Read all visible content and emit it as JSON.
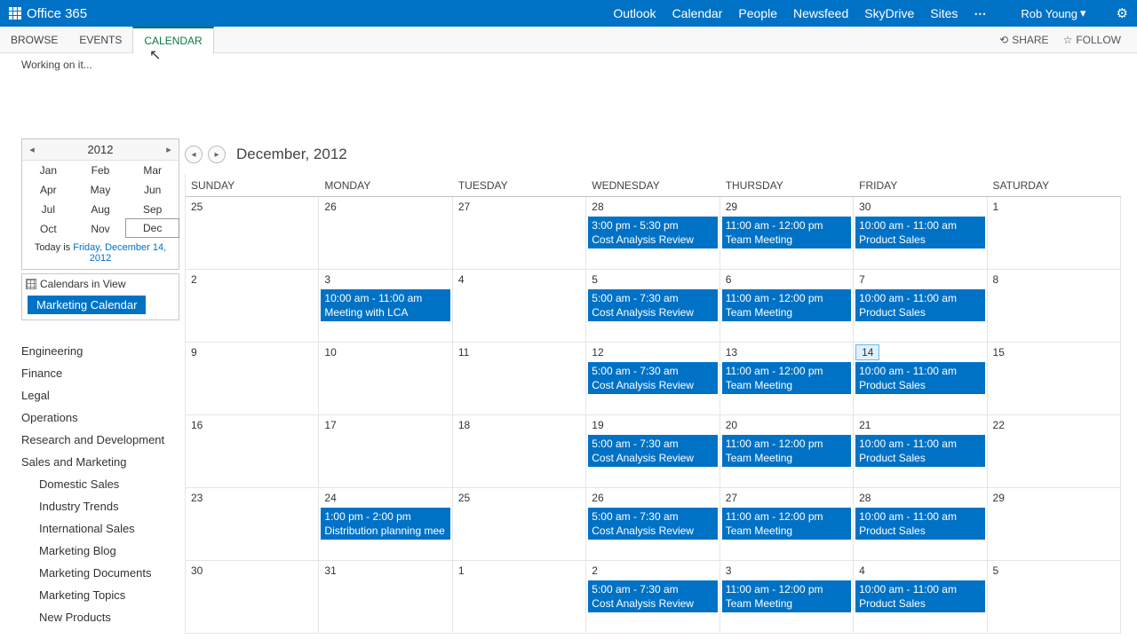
{
  "suite": {
    "brand": "Office 365",
    "nav": [
      "Outlook",
      "Calendar",
      "People",
      "Newsfeed",
      "SkyDrive",
      "Sites"
    ],
    "user": "Rob Young"
  },
  "ribbon": {
    "tabs": [
      "BROWSE",
      "EVENTS",
      "CALENDAR"
    ],
    "active": 2,
    "share": "SHARE",
    "follow": "FOLLOW",
    "status": "Working on it..."
  },
  "datepicker": {
    "year": "2012",
    "months": [
      "Jan",
      "Feb",
      "Mar",
      "Apr",
      "May",
      "Jun",
      "Jul",
      "Aug",
      "Sep",
      "Oct",
      "Nov",
      "Dec"
    ],
    "selected": "Dec",
    "today_prefix": "Today is ",
    "today_link": "Friday, December 14, 2012"
  },
  "civ": {
    "label": "Calendars in View",
    "selected": "Marketing Calendar"
  },
  "tree": {
    "nodes": [
      "Engineering",
      "Finance",
      "Legal",
      "Operations",
      "Research and Development",
      "Sales and Marketing"
    ],
    "subnodes": [
      "Domestic Sales",
      "Industry Trends",
      "International Sales",
      "Marketing Blog",
      "Marketing Documents",
      "Marketing Topics",
      "New Products"
    ]
  },
  "calendar": {
    "title": "December, 2012",
    "days": [
      "SUNDAY",
      "MONDAY",
      "TUESDAY",
      "WEDNESDAY",
      "THURSDAY",
      "FRIDAY",
      "SATURDAY"
    ],
    "today": "14",
    "weeks": [
      [
        {
          "n": "25"
        },
        {
          "n": "26"
        },
        {
          "n": "27"
        },
        {
          "n": "28",
          "e": {
            "t": "3:00 pm - 5:30 pm",
            "s": "Cost Analysis Review"
          }
        },
        {
          "n": "29",
          "e": {
            "t": "11:00 am - 12:00 pm",
            "s": "Team Meeting"
          }
        },
        {
          "n": "30",
          "e": {
            "t": "10:00 am - 11:00 am",
            "s": "Product Sales"
          }
        },
        {
          "n": "1"
        }
      ],
      [
        {
          "n": "2"
        },
        {
          "n": "3",
          "e": {
            "t": "10:00 am - 11:00 am",
            "s": "Meeting with LCA"
          }
        },
        {
          "n": "4"
        },
        {
          "n": "5",
          "e": {
            "t": "5:00 am - 7:30 am",
            "s": "Cost Analysis Review"
          }
        },
        {
          "n": "6",
          "e": {
            "t": "11:00 am - 12:00 pm",
            "s": "Team Meeting"
          }
        },
        {
          "n": "7",
          "e": {
            "t": "10:00 am - 11:00 am",
            "s": "Product Sales"
          }
        },
        {
          "n": "8"
        }
      ],
      [
        {
          "n": "9"
        },
        {
          "n": "10"
        },
        {
          "n": "11"
        },
        {
          "n": "12",
          "e": {
            "t": "5:00 am - 7:30 am",
            "s": "Cost Analysis Review"
          }
        },
        {
          "n": "13",
          "e": {
            "t": "11:00 am - 12:00 pm",
            "s": "Team Meeting"
          }
        },
        {
          "n": "14",
          "e": {
            "t": "10:00 am - 11:00 am",
            "s": "Product Sales"
          }
        },
        {
          "n": "15"
        }
      ],
      [
        {
          "n": "16"
        },
        {
          "n": "17"
        },
        {
          "n": "18"
        },
        {
          "n": "19",
          "e": {
            "t": "5:00 am - 7:30 am",
            "s": "Cost Analysis Review"
          }
        },
        {
          "n": "20",
          "e": {
            "t": "11:00 am - 12:00 pm",
            "s": "Team Meeting"
          }
        },
        {
          "n": "21",
          "e": {
            "t": "10:00 am - 11:00 am",
            "s": "Product Sales"
          }
        },
        {
          "n": "22"
        }
      ],
      [
        {
          "n": "23"
        },
        {
          "n": "24",
          "e": {
            "t": "1:00 pm - 2:00 pm",
            "s": "Distribution planning mee"
          }
        },
        {
          "n": "25"
        },
        {
          "n": "26",
          "e": {
            "t": "5:00 am - 7:30 am",
            "s": "Cost Analysis Review"
          }
        },
        {
          "n": "27",
          "e": {
            "t": "11:00 am - 12:00 pm",
            "s": "Team Meeting"
          }
        },
        {
          "n": "28",
          "e": {
            "t": "10:00 am - 11:00 am",
            "s": "Product Sales"
          }
        },
        {
          "n": "29"
        }
      ],
      [
        {
          "n": "30"
        },
        {
          "n": "31"
        },
        {
          "n": "1"
        },
        {
          "n": "2",
          "e": {
            "t": "5:00 am - 7:30 am",
            "s": "Cost Analysis Review"
          }
        },
        {
          "n": "3",
          "e": {
            "t": "11:00 am - 12:00 pm",
            "s": "Team Meeting"
          }
        },
        {
          "n": "4",
          "e": {
            "t": "10:00 am - 11:00 am",
            "s": "Product Sales"
          }
        },
        {
          "n": "5"
        }
      ]
    ]
  }
}
